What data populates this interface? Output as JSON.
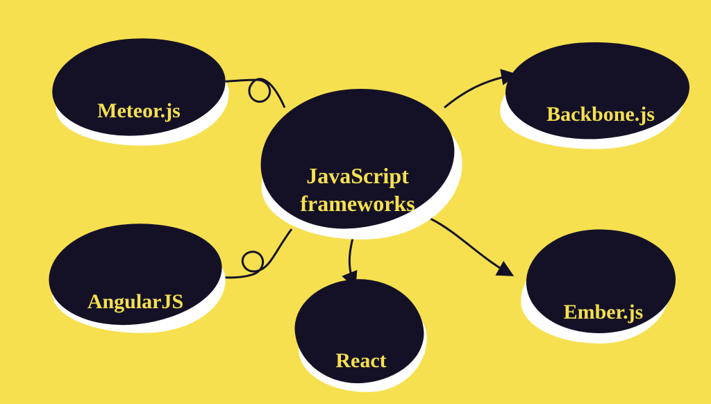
{
  "center": {
    "line1": "JavaScript",
    "line2": "frameworks"
  },
  "nodes": {
    "meteor": {
      "label": "Meteor.js"
    },
    "backbone": {
      "label": "Backbone.js"
    },
    "angular": {
      "label": "AngularJS"
    },
    "react": {
      "label": "React"
    },
    "ember": {
      "label": "Ember.js"
    }
  },
  "colors": {
    "bg": "#f6e050",
    "blob": "#141127",
    "shadow": "#ffffff",
    "text": "#f6e050",
    "arrow": "#141127"
  }
}
